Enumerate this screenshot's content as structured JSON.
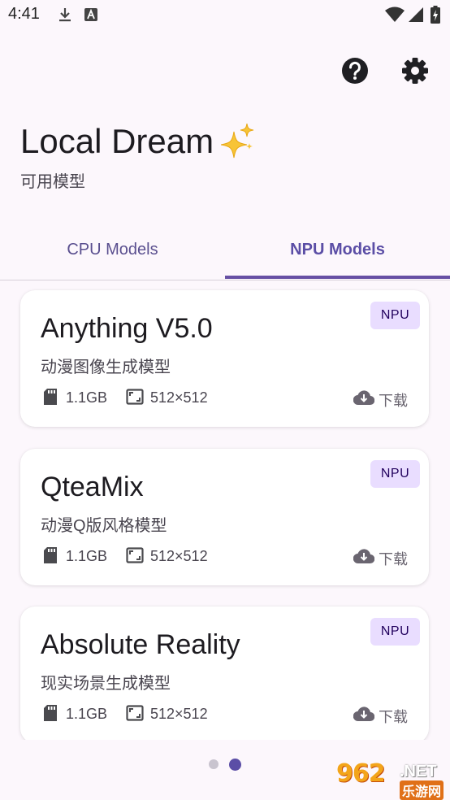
{
  "status_bar": {
    "time": "4:41"
  },
  "header": {
    "title": "Local Dream",
    "subtitle": "可用模型",
    "help_icon": "help-circle-icon",
    "settings_icon": "gear-icon"
  },
  "tabs": [
    {
      "label": "CPU Models",
      "selected": false
    },
    {
      "label": "NPU Models",
      "selected": true
    }
  ],
  "models": [
    {
      "name": "Anything V5.0",
      "description": "动漫图像生成模型",
      "badge": "NPU",
      "size": "1.1GB",
      "resolution": "512×512",
      "download_label": "下载"
    },
    {
      "name": "QteaMix",
      "description": "动漫Q版风格模型",
      "badge": "NPU",
      "size": "1.1GB",
      "resolution": "512×512",
      "download_label": "下载"
    },
    {
      "name": "Absolute Reality",
      "description": "现实场景生成模型",
      "badge": "NPU",
      "size": "1.1GB",
      "resolution": "512×512",
      "download_label": "下载"
    }
  ],
  "pager": {
    "page_count": 2,
    "current_page": 2
  },
  "watermark": {
    "logo": "962",
    "suffix": ".NET",
    "caption": "乐游网"
  },
  "colors": {
    "accent": "#6750a4",
    "badge_bg": "#e9ddff",
    "background": "#fcf7fc"
  }
}
